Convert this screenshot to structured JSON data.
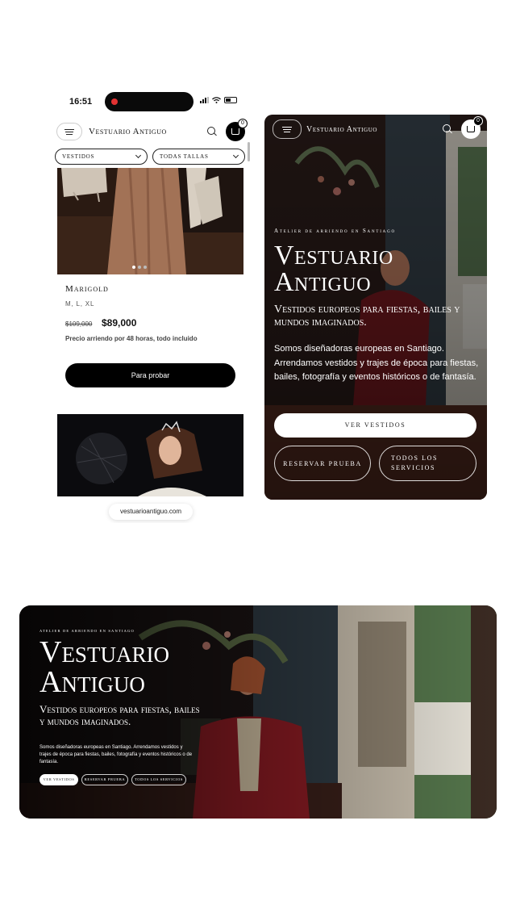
{
  "phone_listing": {
    "status_time": "16:51",
    "brand": "Vestuario Antiguo",
    "cart_count": "0",
    "filters": [
      {
        "label": "VESTIDOS"
      },
      {
        "label": "TODAS TALLAS"
      }
    ],
    "product": {
      "name": "Marigold",
      "sizes": "M, L, XL",
      "price_old": "$109,000",
      "price_new": "$89,000",
      "price_note": "Precio arriendo por 48 horas, todo incluido",
      "cta": "Para probar"
    },
    "carousel": {
      "count": 3,
      "active": 1
    },
    "url": "vestuarioantiguo.com"
  },
  "phone_hero": {
    "brand": "Vestuario Antiguo",
    "cart_count": "0",
    "eyebrow": "Atelier de arriendo en Santiago",
    "title_line1": "Vestuario",
    "title_line2": "Antiguo",
    "subtitle": "Vestidos europeos para fiestas, bailes y mundos imaginados.",
    "body": "Somos diseñadoras europeas en Santiago. Arrendamos vestidos y trajes de época para fiestas, bailes, fotografía y eventos históricos o de fantasía.",
    "btn_primary": "VER VESTIDOS",
    "btn_secondary": "RESERVAR PRUEBA",
    "btn_tertiary": "TODOS LOS SERVICIOS"
  },
  "desktop_hero": {
    "eyebrow": "ATELIER DE ARRIENDO EN SANTIAGO",
    "title_line1": "Vestuario",
    "title_line2": "Antiguo",
    "subtitle": "Vestidos europeos para fiestas, bailes y mundos imaginados.",
    "body": "Somos diseñadoras europeas en Santiago. Arrendamos vestidos y trajes de época para fiestas, bailes, fotografía y eventos históricos o de fantasía.",
    "btn_primary": "VER VESTIDOS",
    "btn_secondary": "RESERVAR PRUEBA",
    "btn_tertiary": "TODOS LOS SERVICIOS"
  },
  "colors": {
    "ink": "#111111",
    "button_dark": "#000000",
    "hero_overlay": "#1a0f12",
    "dress_red": "#9b1b25",
    "window_green": "#4f7d4a"
  }
}
